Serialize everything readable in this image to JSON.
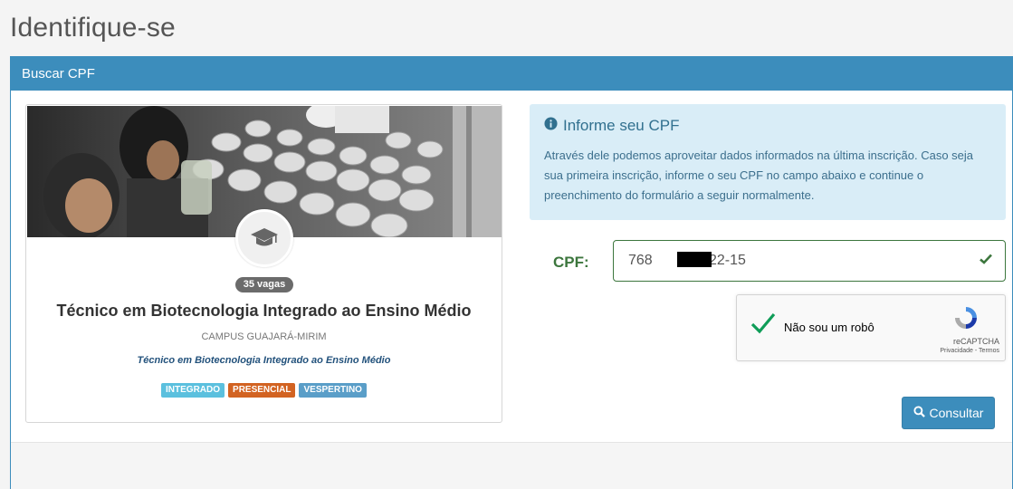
{
  "page": {
    "title": "Identifique-se"
  },
  "panel": {
    "heading": "Buscar CPF"
  },
  "course_card": {
    "vagas": "35 vagas",
    "title": "Técnico em Biotecnologia Integrado ao Ensino Médio",
    "campus": "CAMPUS GUAJARÁ-MIRIM",
    "subtitle": "Técnico em Biotecnologia Integrado ao Ensino Médio",
    "tags": [
      "INTEGRADO",
      "PRESENCIAL",
      "VESPERTINO"
    ],
    "avatar_icon": "graduation-cap-icon"
  },
  "info": {
    "title": "Informe seu CPF",
    "text": "Através dele podemos aproveitar dados informados na última inscrição. Caso seja sua primeira inscrição, informe o seu CPF no campo abaixo e continue o preenchimento do formulário a seguir normalmente.",
    "icon": "info-circle-icon"
  },
  "form": {
    "cpf_label": "CPF:",
    "cpf_value": "768            622-15"
  },
  "recaptcha": {
    "label": "Não sou um robô",
    "brand": "reCAPTCHA",
    "links": "Privacidade - Termos"
  },
  "actions": {
    "consultar": "Consultar"
  },
  "colors": {
    "primary": "#3c8dbc",
    "success": "#3c763d",
    "info_bg": "#d9edf7",
    "tag_integrado": "#5bc0de",
    "tag_presencial": "#d26322",
    "tag_vespertino": "#5a9ec8"
  }
}
